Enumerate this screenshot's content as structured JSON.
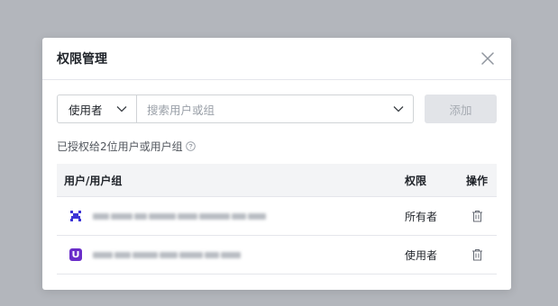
{
  "dialog": {
    "title": "权限管理"
  },
  "controls": {
    "role_value": "使用者",
    "search_placeholder": "搜索用户或组",
    "add_label": "添加"
  },
  "summary": {
    "text": "已授权给2位用户或用户组"
  },
  "table": {
    "headers": {
      "user": "用户/用户组",
      "permission": "权限",
      "action": "操作"
    },
    "rows": [
      {
        "permission": "所有者",
        "avatar_color": "#3d35d6"
      },
      {
        "permission": "使用者",
        "avatar_color": "#6a2dc9"
      }
    ]
  },
  "icons": {
    "close": "close-icon",
    "chevron": "chevron-down-icon",
    "help": "help-circle-icon",
    "delete": "trash-icon"
  }
}
